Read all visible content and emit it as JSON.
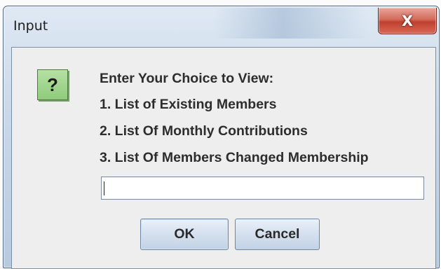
{
  "window": {
    "title": "Input",
    "close_symbol": "X"
  },
  "dialog": {
    "icon": "question-mark-icon",
    "icon_glyph": "?",
    "lines": [
      "Enter Your Choice to View:",
      "1. List of Existing Members",
      "2. List Of Monthly Contributions",
      "3. List Of Members Changed Membership"
    ],
    "input_value": "",
    "buttons": {
      "ok_label": "OK",
      "cancel_label": "Cancel"
    }
  },
  "colors": {
    "close_button": "#c9503f",
    "icon_background": "#9fd48b",
    "dialog_background": "#eeeeee"
  }
}
